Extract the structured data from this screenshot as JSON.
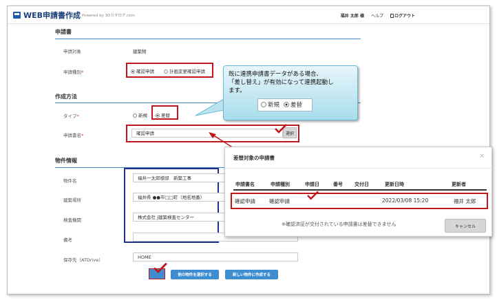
{
  "header": {
    "app_title": "WEB申請書作成",
    "powered": "Powered by 3Dカタログ.com",
    "user": "福井 太郎 様",
    "help": "ヘルプ",
    "logout": "ログアウト"
  },
  "sections": {
    "application": "申請書",
    "method": "作成方法",
    "property": "物件情報"
  },
  "fields": {
    "target_label": "申請対象",
    "target_value": "建築物",
    "type_label": "申請種別",
    "type_opt1": "確認申請",
    "type_opt2": "計画変更確認申請",
    "kind_label": "タイプ",
    "kind_opt1": "新規",
    "kind_opt2": "差替",
    "docname_label": "申請書名",
    "docname_value": "確認申請",
    "select_button": "選択",
    "prop_name_label": "物件名",
    "prop_name_value": "福井一太郎様邸　新築工事",
    "location_label": "建築場所",
    "location_value": "福井県 ●●市□□町（地名地番）",
    "agency_label": "検査機関",
    "agency_value": "株式会社 J建築検査センター",
    "note_label": "備考",
    "note_value": "",
    "save_label": "保存先（ATDrive）",
    "save_value": "HOME",
    "required_mark": "*"
  },
  "buttons": {
    "other": "他の物件を選択する",
    "new": "新しい物件に作成する"
  },
  "callout": {
    "line1": "既に連携申請書データがある場合、",
    "line2": "「差し替え」が有効になって連携起動し",
    "line3": "ます。",
    "opt1": "新規",
    "opt2": "差替"
  },
  "modal": {
    "title": "差替対象の申請書",
    "close": "×",
    "headers": [
      "申請書名",
      "申請種別",
      "申請日",
      "番号",
      "交付日",
      "更新日時",
      "更新者"
    ],
    "row": [
      "確認申請",
      "確認申請",
      "",
      "",
      "",
      "2022/03/08 15:20",
      "福井 太郎"
    ],
    "note": "※確認済証が交付されている申請書は差替できません",
    "cancel": "キャンセル"
  },
  "colors": {
    "accent": "#c0161c",
    "brand": "#1f5da8",
    "button": "#3f8dd1"
  }
}
